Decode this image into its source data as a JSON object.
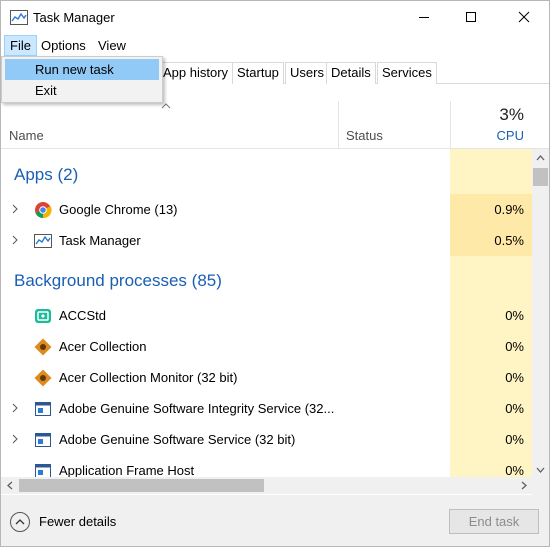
{
  "window": {
    "title": "Task Manager",
    "accent_color": "#1a5fb4"
  },
  "menu": {
    "items": [
      "File",
      "Options",
      "View"
    ],
    "file_menu": [
      "Run new task",
      "Exit"
    ]
  },
  "tabs": [
    "App history",
    "Startup",
    "Users",
    "Details",
    "Services"
  ],
  "columns": {
    "name": "Name",
    "status": "Status",
    "cpu_percent": "3%",
    "cpu_label": "CPU"
  },
  "groups": {
    "apps": "Apps (2)",
    "background": "Background processes (85)"
  },
  "apps": [
    {
      "name": "Google Chrome (13)",
      "cpu": "0.9%",
      "icon": "chrome-icon"
    },
    {
      "name": "Task Manager",
      "cpu": "0.5%",
      "icon": "task-manager-icon"
    }
  ],
  "background": [
    {
      "name": "ACCStd",
      "cpu": "0%",
      "icon": "accstd-icon"
    },
    {
      "name": "Acer Collection",
      "cpu": "0%",
      "icon": "acer-collection-icon"
    },
    {
      "name": "Acer Collection Monitor (32 bit)",
      "cpu": "0%",
      "icon": "acer-collection-icon"
    },
    {
      "name": "Adobe Genuine Software Integrity Service (32...",
      "cpu": "0%",
      "icon": "service-window-icon"
    },
    {
      "name": "Adobe Genuine Software Service (32 bit)",
      "cpu": "0%",
      "icon": "service-window-icon"
    },
    {
      "name": "Application Frame Host",
      "cpu": "0%",
      "icon": "service-window-icon"
    }
  ],
  "footer": {
    "fewer_details": "Fewer details",
    "end_task": "End task"
  }
}
